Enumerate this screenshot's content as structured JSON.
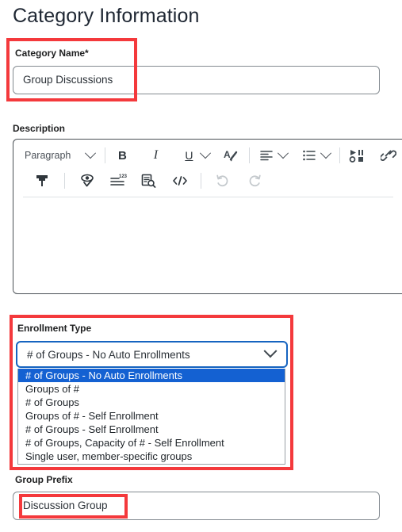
{
  "page": {
    "title": "Category Information"
  },
  "category_name": {
    "label": "Category Name",
    "required_marker": "*",
    "value": "Group Discussions"
  },
  "description": {
    "label": "Description",
    "value": "",
    "editor": {
      "paragraph_style": "Paragraph",
      "bold_label": "B",
      "italic_label": "I",
      "underline_label": "U",
      "buttons": [
        {
          "name": "paragraph-style-select",
          "label": "Paragraph"
        },
        {
          "name": "bold-button",
          "label": "B"
        },
        {
          "name": "italic-button",
          "label": "I"
        },
        {
          "name": "underline-button",
          "label": "U"
        },
        {
          "name": "text-color-button",
          "label": "A"
        },
        {
          "name": "align-button",
          "label": "align"
        },
        {
          "name": "list-button",
          "label": "list"
        },
        {
          "name": "insert-media-button",
          "label": "media"
        },
        {
          "name": "insert-link-button",
          "label": "link"
        },
        {
          "name": "format-painter-button",
          "label": "format-painter"
        },
        {
          "name": "accessibility-check-button",
          "label": "accessibility"
        },
        {
          "name": "word-count-button",
          "label": "word-count"
        },
        {
          "name": "preview-button",
          "label": "preview"
        },
        {
          "name": "source-code-button",
          "label": "</>"
        },
        {
          "name": "undo-button",
          "label": "undo"
        },
        {
          "name": "redo-button",
          "label": "redo"
        }
      ]
    }
  },
  "enrollment_type": {
    "label": "Enrollment Type",
    "selected": "# of Groups - No Auto Enrollments",
    "options": [
      "# of Groups - No Auto Enrollments",
      "Groups of #",
      "# of Groups",
      "Groups of # - Self Enrollment",
      "# of Groups - Self Enrollment",
      "# of Groups, Capacity of # - Self Enrollment",
      "Single user, member-specific groups"
    ],
    "selected_index": 0
  },
  "group_prefix": {
    "label": "Group Prefix",
    "value": "Discussion Group"
  },
  "annotations": {
    "highlight_color": "#f4393c",
    "boxes": [
      {
        "name": "category-name-highlight"
      },
      {
        "name": "enrollment-type-highlight"
      },
      {
        "name": "group-prefix-highlight"
      }
    ]
  },
  "colors": {
    "accent_blue": "#1664c0",
    "option_selected_bg": "#1461d2",
    "annotation_red": "#f4393c"
  }
}
